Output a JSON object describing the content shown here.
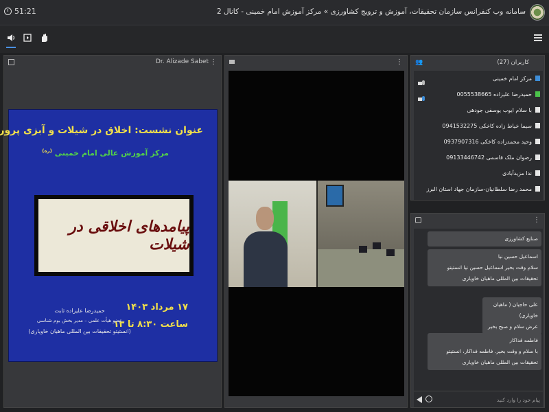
{
  "header": {
    "timer": "51:21",
    "title": "سامانه وب کنفرانس سازمان تحقیقات، آموزش و ترویج کشاورزی » مرکز آموزش امام خمینی - کانال 2"
  },
  "presentation": {
    "presenter": "Dr. Alizade Sabet",
    "slide": {
      "title": "عنوان نشست: اخلاق در شیلات و آبزی پروری",
      "subtitle": "مرکز آموزش عالی امام خمینی",
      "subtitle_sup": "(ره)",
      "box_text": "پیامدهای اخلاقی در شیلات",
      "date_line1": "۱۷ مرداد ۱۴۰۳",
      "date_line2": "ساعت ۸:۳۰ تا ۱۳",
      "author_name": "حمیدرضا علیزاده ثابت",
      "author_role": "عضو هیأت علمی – مدیر بخش بوم شناسی",
      "author_org": "(انستیتو تحقیقات بین المللی ماهیان خاویاری)"
    }
  },
  "users": {
    "header": "کاربران (27)",
    "list": [
      {
        "name": "مرکز امام خمینی",
        "color": "blue"
      },
      {
        "name": "حمیدرضا علیزاده 0055538665",
        "color": "green"
      },
      {
        "name": "با سلام ایوب یوسفی جودهی",
        "color": "white"
      },
      {
        "name": "سیما خیاط زاده کاخکی 0941532275",
        "color": "white"
      },
      {
        "name": "وحید محمدزاده کاخکی 0937907316",
        "color": "white"
      },
      {
        "name": "رضوان ملک قاسمی 09133446742",
        "color": "white"
      },
      {
        "name": "ندا مزیدآبادی",
        "color": "white"
      },
      {
        "name": "محمد رضا سلطانیان-سازمان جهاد استان البرز",
        "color": "white"
      }
    ]
  },
  "chat": {
    "messages": [
      {
        "name": "صنایع کشاورزی",
        "text": ""
      },
      {
        "name": "اسماعیل حسین نیا",
        "text": "سلام وقت بخیر اسماعیل حسین نیا انستیتو تحقیقات بین المللی ماهیان خاویاری"
      },
      {
        "name": "علی حاجیان ( ماهیان خاویاری)",
        "text": "عرض سلام و صبح بخیر"
      },
      {
        "name": "فاطمه قداکار",
        "text": "با سلام و وقت بخیر. فاطمه فداکار، انستیتو تحقیقات بین المللی ماهیان خاویاری"
      }
    ],
    "input_placeholder": "پیام خود را وارد کنید"
  },
  "colors": {
    "accent": "#4a90e2",
    "slide_bg": "#1e2fa3",
    "slide_title": "#f2e04a",
    "slide_sub": "#52d04a"
  }
}
